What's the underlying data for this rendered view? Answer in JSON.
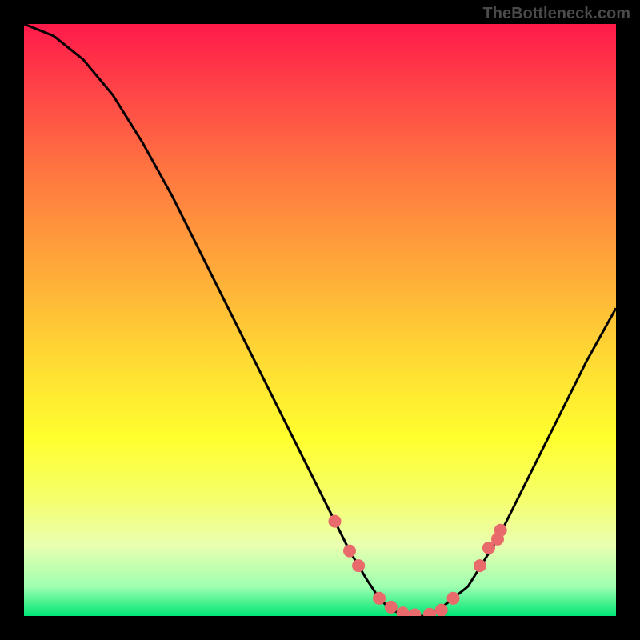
{
  "attribution": "TheBottleneck.com",
  "chart_data": {
    "type": "line",
    "title": "",
    "xlabel": "",
    "ylabel": "",
    "xlim": [
      0,
      100
    ],
    "ylim": [
      0,
      100
    ],
    "curve": {
      "x": [
        0,
        5,
        10,
        15,
        20,
        25,
        30,
        35,
        40,
        45,
        50,
        55,
        58,
        60,
        62,
        65,
        68,
        70,
        75,
        80,
        85,
        90,
        95,
        100
      ],
      "y": [
        100,
        98,
        94,
        88,
        80,
        71,
        61,
        51,
        41,
        31,
        21,
        11,
        6,
        3,
        1,
        0,
        0,
        1,
        5,
        13,
        23,
        33,
        43,
        52
      ]
    },
    "dots": {
      "x": [
        52.5,
        55.0,
        56.5,
        60.0,
        62.0,
        64.0,
        66.0,
        68.5,
        70.5,
        72.5,
        77.0,
        78.5,
        80.0,
        80.5
      ],
      "y": [
        16.0,
        11.0,
        8.5,
        3.0,
        1.5,
        0.5,
        0.2,
        0.3,
        1.0,
        3.0,
        8.5,
        11.5,
        13.0,
        14.5
      ]
    },
    "colors": {
      "curve": "#000000",
      "dots": "#e86a6a"
    }
  }
}
